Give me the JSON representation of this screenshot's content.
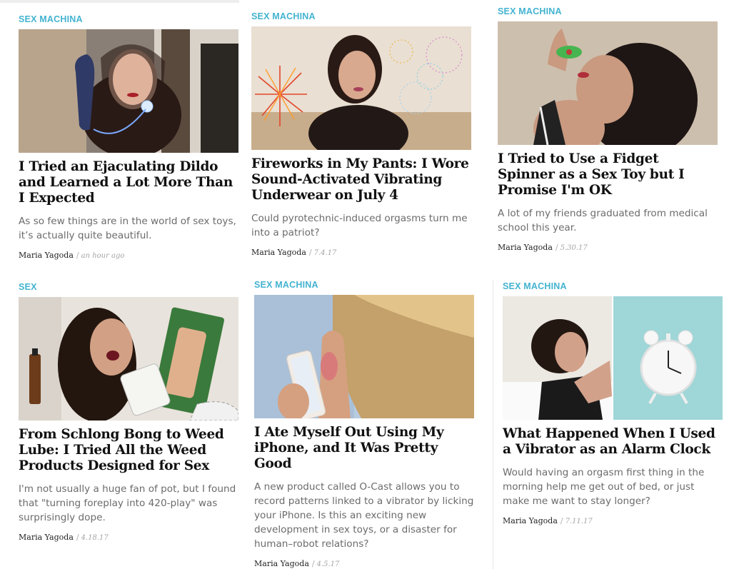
{
  "articles": [
    {
      "category": "SEX MACHINA",
      "title": "I Tried an Ejaculating Dildo and Learned a Lot More Than I Expected",
      "dek": "As so few things are in the world of sex toys, it’s actually quite beautiful.",
      "author": "Maria Yagoda",
      "date": "an hour ago"
    },
    {
      "category": "SEX MACHINA",
      "title": "Fireworks in My Pants: I Wore Sound-Activated Vibrating Underwear on July 4",
      "dek": "Could pyrotechnic-induced orgasms turn me into a patriot?",
      "author": "Maria Yagoda",
      "date": "7.4.17"
    },
    {
      "category": "SEX MACHINA",
      "title": "I Tried to Use a Fidget Spinner as a Sex Toy but I Promise I'm OK",
      "dek": "A lot of my friends graduated from medical school this year.",
      "author": "Maria Yagoda",
      "date": "5.30.17"
    },
    {
      "category": "SEX",
      "title": "From Schlong Bong to Weed Lube: I Tried All the Weed Products Designed for Sex",
      "dek": "I'm not usually a huge fan of pot, but I found that \"turning foreplay into 420-play\" was surprisingly dope.",
      "author": "Maria Yagoda",
      "date": "4.18.17"
    },
    {
      "category": "SEX MACHINA",
      "title": "I Ate Myself Out Using My iPhone, and It Was Pretty Good",
      "dek": "A new product called O-Cast allows you to record patterns linked to a vibrator by licking your iPhone. Is this an exciting new development in sex toys, or a disaster for human–robot relations?",
      "author": "Maria Yagoda",
      "date": "4.5.17"
    },
    {
      "category": "SEX MACHINA",
      "title": "What Happened When I Used a Vibrator as an Alarm Clock",
      "dek": "Would having an orgasm first thing in the morning help me get out of bed, or just make me want to stay longer?",
      "author": "Maria Yagoda",
      "date": "7.11.17"
    }
  ],
  "byline_separator": "/"
}
